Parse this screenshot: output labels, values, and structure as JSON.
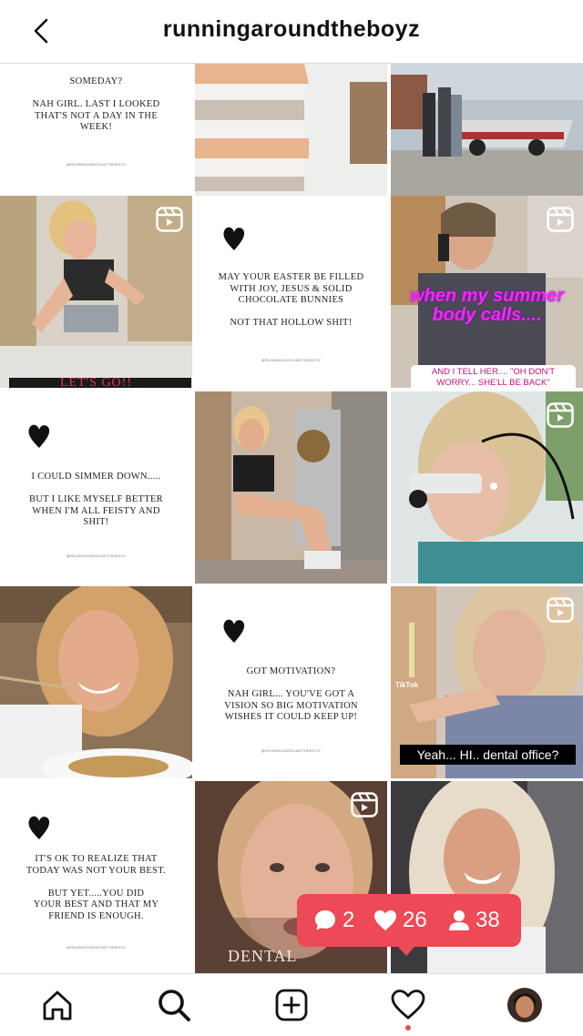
{
  "header": {
    "title": "runningaroundtheboyz"
  },
  "signature": "@RUNNINGAROUNDTHEBOYZ",
  "quotes": {
    "q1": "SOMEDAY?\n\nNAH GIRL. LAST I LOOKED\nTHAT'S NOT A DAY IN THE\nWEEK!",
    "q2": "MAY YOUR EASTER BE FILLED\nWITH JOY, JESUS & SOLID\nCHOCOLATE BUNNIES\n\nNOT THAT HOLLOW SHIT!",
    "q3": "I COULD SIMMER DOWN.....\n\nBUT I LIKE MYSELF BETTER\nWHEN I'M ALL FEISTY AND\nSHIT!",
    "q4": "GOT MOTIVATION?\n\nNAH GIRL... YOU'VE GOT A\nVISION SO BIG MOTIVATION\nWISHES IT COULD KEEP UP!",
    "q5": "IT'S OK TO REALIZE THAT\nTODAY WAS NOT YOUR BEST.\n\nBUT YET.....YOU DID\nYOUR BEST AND THAT MY\nFRIEND IS ENOUGH."
  },
  "captions": {
    "lets_go": "LET'S GO!!",
    "summer": "when my summer\nbody calls....",
    "summer_sub": "AND I TELL HER.... \"OH DON'T\nWORRY... SHE'LL BE BACK\"",
    "tiktok": "TikTok",
    "dental_office": "Yeah... HI.. dental office?",
    "dental": "DENTAL"
  },
  "activity": {
    "comments": "2",
    "likes": "26",
    "follows": "38"
  },
  "colors": {
    "accent": "#ed4956",
    "border": "#dbdbdb"
  }
}
